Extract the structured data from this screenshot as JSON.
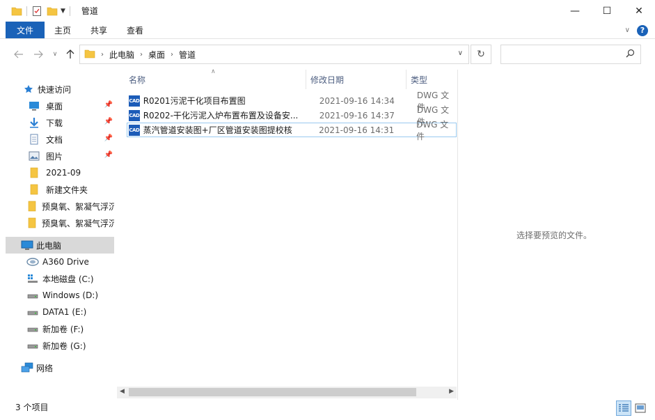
{
  "window": {
    "title": "管道",
    "controls": {
      "minimize": "—",
      "maximize": "☐",
      "close": "✕"
    }
  },
  "ribbon": {
    "tabs": [
      {
        "label": "文件"
      },
      {
        "label": "主页"
      },
      {
        "label": "共享"
      },
      {
        "label": "查看"
      }
    ],
    "help": "?"
  },
  "address": {
    "crumbs": [
      "此电脑",
      "桌面",
      "管道"
    ]
  },
  "sidebar": {
    "items": [
      {
        "label": "快速访问",
        "icon": "star-icon",
        "pinned": false
      },
      {
        "label": "桌面",
        "icon": "desktop-icon",
        "pinned": true
      },
      {
        "label": "下载",
        "icon": "download-icon",
        "pinned": true
      },
      {
        "label": "文档",
        "icon": "document-icon",
        "pinned": true
      },
      {
        "label": "图片",
        "icon": "picture-icon",
        "pinned": true
      },
      {
        "label": "2021-09",
        "icon": "folder-icon",
        "pinned": false
      },
      {
        "label": "新建文件夹",
        "icon": "folder-icon",
        "pinned": false
      },
      {
        "label": "预臭氧、絮凝气浮沉",
        "icon": "folder-icon",
        "pinned": false
      },
      {
        "label": "预臭氧、絮凝气浮沉",
        "icon": "folder-icon",
        "pinned": false
      },
      {
        "label": "此电脑",
        "icon": "computer-icon",
        "pinned": false,
        "selected": true
      },
      {
        "label": "A360 Drive",
        "icon": "cloud-drive-icon",
        "pinned": false
      },
      {
        "label": "本地磁盘 (C:)",
        "icon": "system-drive-icon",
        "pinned": false
      },
      {
        "label": "Windows (D:)",
        "icon": "drive-icon",
        "pinned": false
      },
      {
        "label": "DATA1 (E:)",
        "icon": "drive-icon",
        "pinned": false
      },
      {
        "label": "新加卷 (F:)",
        "icon": "drive-icon",
        "pinned": false
      },
      {
        "label": "新加卷 (G:)",
        "icon": "drive-icon",
        "pinned": false
      },
      {
        "label": "网络",
        "icon": "network-icon",
        "pinned": false
      }
    ]
  },
  "filelist": {
    "columns": {
      "name": "名称",
      "date": "修改日期",
      "type": "类型"
    },
    "files": [
      {
        "icon": "CAD",
        "name": "R0201污泥干化项目布置图",
        "date": "2021-09-16 14:34",
        "type": "DWG 文件"
      },
      {
        "icon": "CAD",
        "name": "R0202-干化污泥入炉布置布置及设备安...",
        "date": "2021-09-16 14:37",
        "type": "DWG 文件"
      },
      {
        "icon": "CAD",
        "name": "蒸汽管道安装图+厂区管道安装图提校核",
        "date": "2021-09-16 14:31",
        "type": "DWG 文件"
      }
    ]
  },
  "preview": {
    "message": "选择要预览的文件。"
  },
  "status": {
    "count": "3 个项目"
  },
  "colors": {
    "accent": "#1a62b8",
    "folder": "#f5c542",
    "selection": "#d9d9d9"
  }
}
